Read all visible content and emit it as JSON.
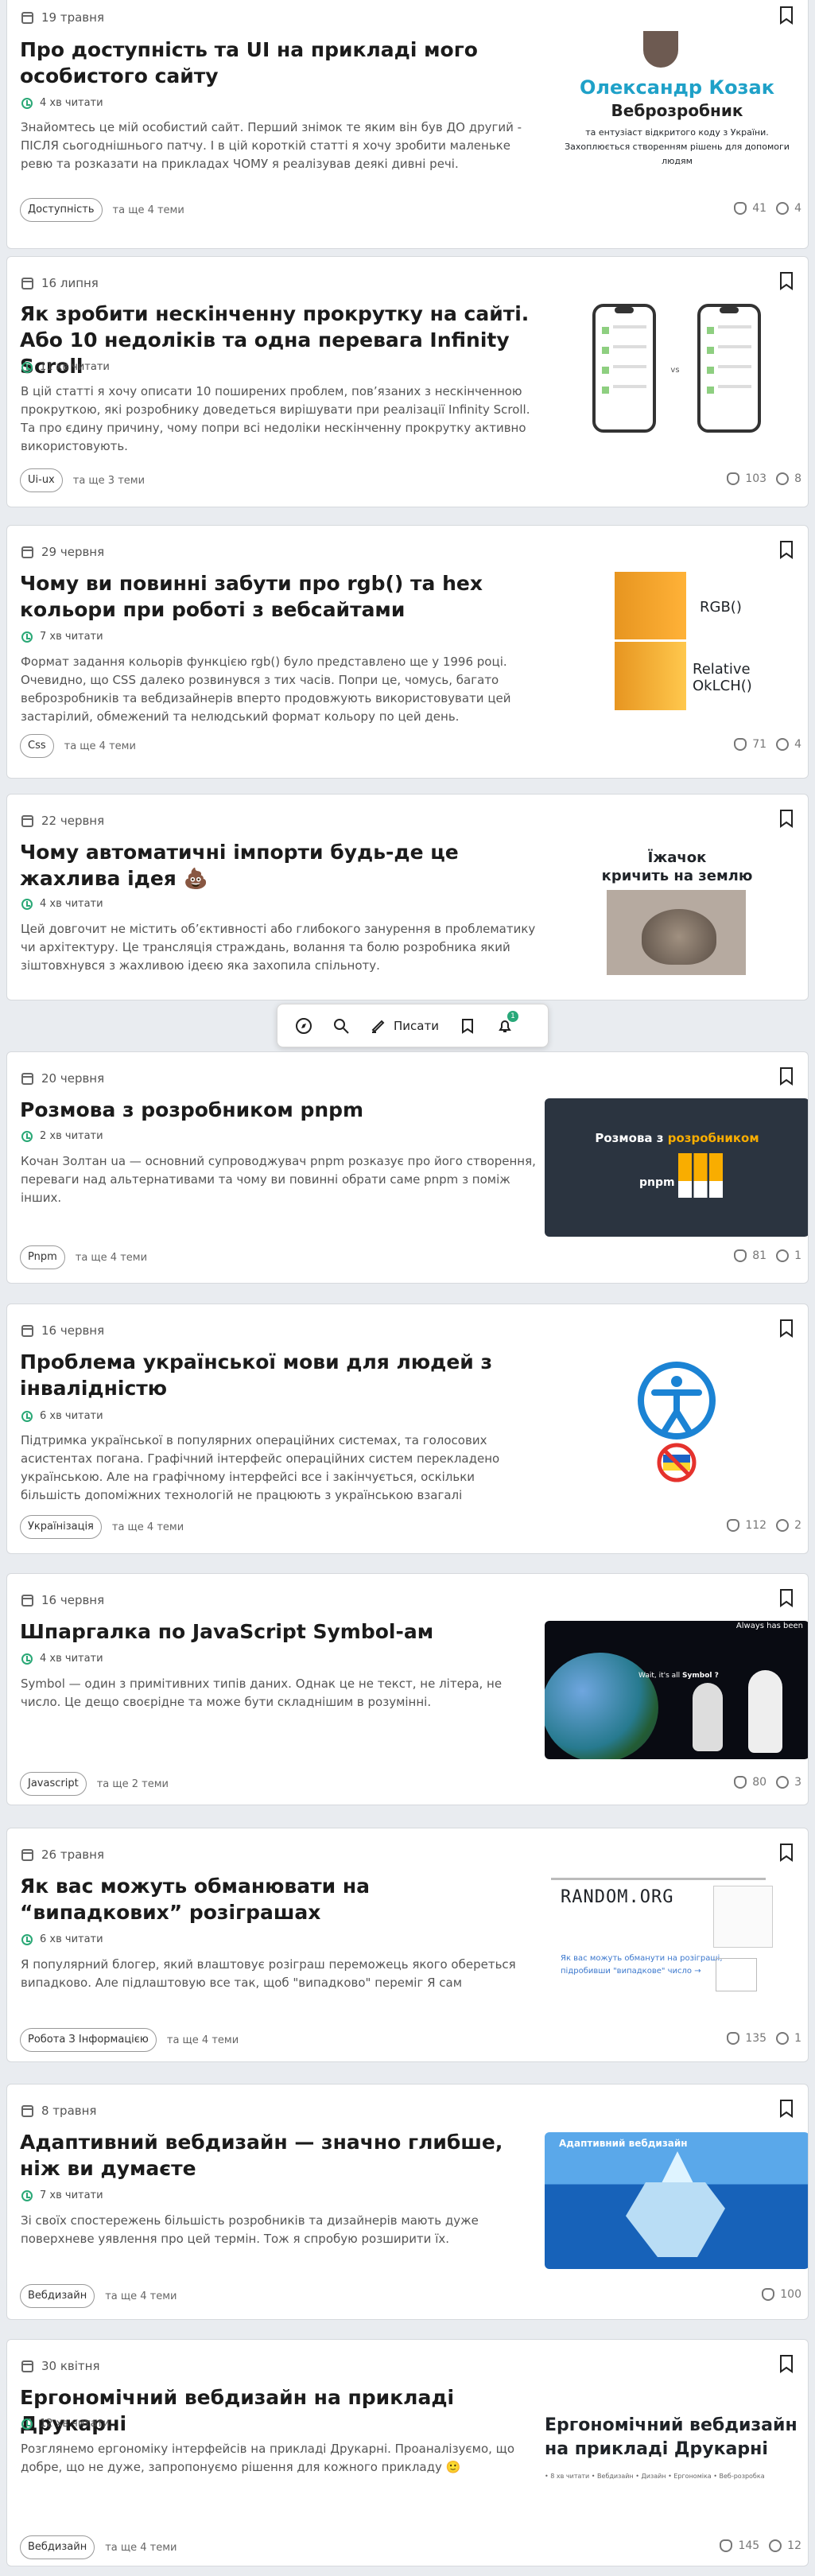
{
  "navigation": {
    "write_label": "Писати",
    "notification_count": "1"
  },
  "posts": [
    {
      "date": "19 травня",
      "title": "Про доступність та UI на прикладі мого особистого сайту",
      "read_time": "4 хв читати",
      "excerpt": "Знайомтесь це мій особистий сайт. Перший знімок те яким він був ДО другий - ПІСЛЯ сьогоднішнього патчу. І в цій короткій статті я хочу зробити маленьке ревю та розказати на прикладах ЧОМУ я реалізував деякі дивні речі.",
      "tag": "Доступність",
      "more_topics": "та ще 4 теми",
      "reactions": "41",
      "comments": "4",
      "thumbnail": {
        "name": "Олександр Козак",
        "role": "Веброзробник",
        "line1": "та ентузіаст відкритого коду з України.",
        "line2": "Захоплюється створенням рішень для допомоги",
        "line3": "людям"
      }
    },
    {
      "date": "16 липня",
      "title": "Як зробити нескінченну прокрутку на сайті. Або 10 недоліків та одна перевага Infinity Scroll",
      "read_time": "11 хв читати",
      "excerpt": "В цій статті я хочу описати 10 поширених проблем, пов’язаних з нескінченною прокруткою, які розробнику доведеться вирішувати при реалізації Infinity Scroll. Та про єдину причину, чому попри всі недоліки нескінченну прокрутку активно використовують.",
      "tag": "Ui-ux",
      "more_topics": "та ще 3 теми",
      "reactions": "103",
      "comments": "8",
      "thumbnail": {
        "vs": "vs"
      }
    },
    {
      "date": "29 червня",
      "title": "Чому ви повинні забути про rgb() та hex кольори при роботі з вебсайтами",
      "read_time": "7 хв читати",
      "excerpt": "Формат задання кольорів функцією rgb() було представлено ще у 1996 році. Очевидно, що CSS далеко розвинувся з тих часів. Попри це, чомусь, багато веброзробників та вебдизайнерів вперто продовжують використовувати цей застарілий, обмежений та нелюдський формат кольору по цей день.",
      "tag": "Css",
      "more_topics": "та ще 4 теми",
      "reactions": "71",
      "comments": "4",
      "thumbnail": {
        "top": "RGB()",
        "bottom1": "Relative",
        "bottom2": "OkLCH()"
      }
    },
    {
      "date": "22 червня",
      "title": "Чому автоматичні імпорти будь-де це жахлива ідея",
      "title_icon": "💩",
      "read_time": "4 хв читати",
      "excerpt": "Цей довгочит не містить об’єктивності або глибокого занурення в проблематику чи архітектуру. Це трансляція страждань, волання та болю розробника який зіштовхнувся з жахливою ідеєю яка захопила спільноту.",
      "thumbnail": {
        "line1": "Їжачок",
        "line2": "кричить на землю"
      }
    },
    {
      "date": "20 червня",
      "title": "Розмова з розробником pnpm",
      "read_time": "2 хв читати",
      "excerpt": "Кочан Золтан ua — основний супроводжувач pnpm розказує про його створення, переваги над альтернативами та чому ви повинні обрати саме pnpm з поміж інших.",
      "tag": "Pnpm",
      "more_topics": "та ще 4 теми",
      "reactions": "81",
      "comments": "1",
      "thumbnail": {
        "text_start": "Розмова з ",
        "text_accent": "розробником",
        "logo": "pnpm"
      }
    },
    {
      "date": "16 червня",
      "title": "Проблема української мови для людей з інвалідністю",
      "read_time": "6 хв читати",
      "excerpt": "Підтримка української в популярних операційних системах, та голосових асистентах погана. Графічний інтерфейс операційних систем перекладено українською. Але на графічному інтерфейсі все і закінчується, оскільки більшість допоміжних технологій не працюють з українською взагалі",
      "tag": "Українізація",
      "more_topics": "та ще 4 теми",
      "reactions": "112",
      "comments": "2"
    },
    {
      "date": "16 червня",
      "title": "Шпаргалка по JavaScript Symbol-ам",
      "read_time": "4 хв читати",
      "excerpt": "Symbol — один з примітивних типів даних. Однак це не текст, не літера, не число. Це дещо своєрідне та може бути складнішим в розумінні.",
      "tag": "Javascript",
      "more_topics": "та ще 2 теми",
      "reactions": "80",
      "comments": "3",
      "thumbnail": {
        "caption": "Always has been",
        "question": "Wait, it's all ",
        "answer": "Symbol ?"
      }
    },
    {
      "date": "26 травня",
      "title": "Як вас можуть обманювати на “випадкових” розіграшах",
      "read_time": "6 хв читати",
      "excerpt": "Я популярний блогер, який влаштовує розіграш переможець якого обереться випадково. Але підлаштовую все так, щоб \"випадково\" переміг Я сам",
      "tag": "Робота З Інформацією",
      "more_topics": "та ще 4 теми",
      "reactions": "135",
      "comments": "1",
      "thumbnail": {
        "logo": "RANDOM.ORG",
        "line1": "Як вас можуть обманути на розіграші,",
        "line2": "підробивши \"випадкове\" число →"
      }
    },
    {
      "date": "8 травня",
      "title": "Адаптивний вебдизайн — значно глибше, ніж ви думаєте",
      "read_time": "7 хв читати",
      "excerpt": "Зі своїх спостережень більшість розробників та дизайнерів мають дуже поверхневе уявлення про цей термін. Тож я спробую розширити їх.",
      "tag": "Вебдизайн",
      "more_topics": "та ще 4 теми",
      "reactions": "100",
      "thumbnail": {
        "title": "Адаптивний вебдизайн"
      }
    },
    {
      "date": "30 квітня",
      "title": "Ергономічний вебдизайн на прикладі Друкарні",
      "read_time": "12 хв читати",
      "excerpt": "Розглянемо ергономіку інтерфейсів на прикладі Друкарні. Проаналізуємо, що добре, що не дуже, запропонуємо рішення для кожного прикладу 🙂",
      "tag": "Вебдизайн",
      "more_topics": "та ще 4 теми",
      "reactions": "145",
      "comments": "12",
      "thumbnail": {
        "title": "Ергономічний вебдизайн на прикладі Друкарні",
        "crumbs": "• 8 хв читати  •  Вебдизайн  •  Дизайн  •  Ергономіка  •  Веб-розробка"
      }
    }
  ],
  "colors": {
    "accent": "#2aa876",
    "pnpm": "#f9ad00",
    "navy": "#2b3440"
  }
}
